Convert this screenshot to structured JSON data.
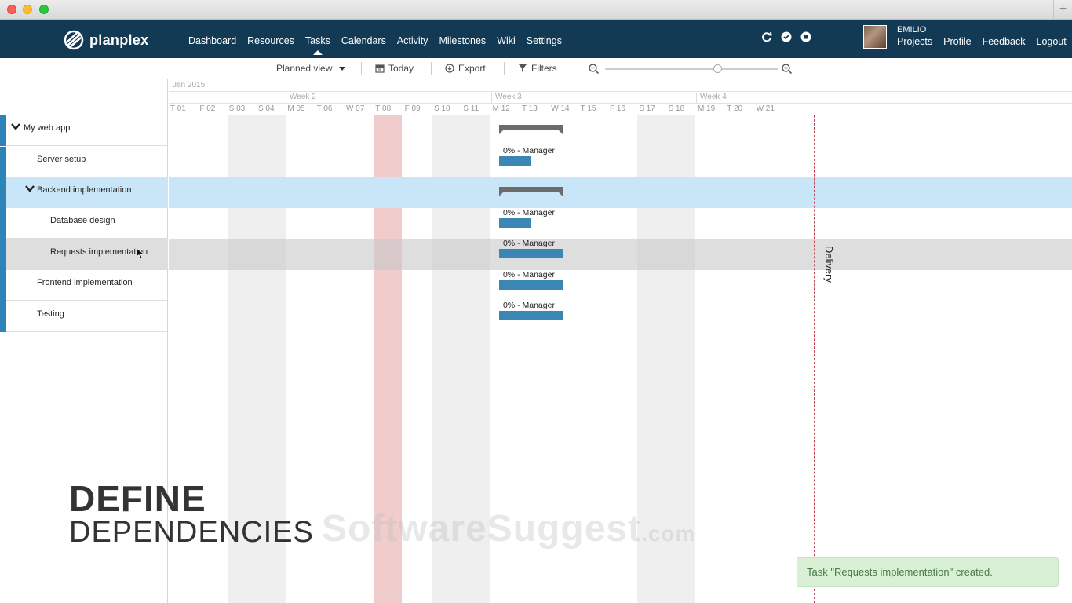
{
  "window": {
    "plus_label": "+"
  },
  "navbar": {
    "logo_text": "planplex",
    "links": [
      "Dashboard",
      "Resources",
      "Tasks",
      "Calendars",
      "Activity",
      "Milestones",
      "Wiki",
      "Settings"
    ],
    "active_link": "Tasks",
    "icons": [
      "refresh-icon",
      "check-circle-icon",
      "stop-circle-icon"
    ],
    "user_name": "EMILIO",
    "user_links": [
      "Projects",
      "Profile",
      "Feedback",
      "Logout"
    ]
  },
  "toolbar": {
    "view_label": "Planned view",
    "today_label": "Today",
    "export_label": "Export",
    "filters_label": "Filters",
    "zoom_level": 0.65
  },
  "timeline": {
    "month": "Jan 2015",
    "weeks": [
      "Week 2",
      "Week 3",
      "Week 4"
    ],
    "days": [
      "T 01",
      "F 02",
      "S 03",
      "S 04",
      "M 05",
      "T 06",
      "W 07",
      "T 08",
      "F 09",
      "S 10",
      "S 11",
      "M 12",
      "T 13",
      "W 14",
      "T 15",
      "F 16",
      "S 17",
      "S 18",
      "M 19",
      "T 20",
      "W 21"
    ]
  },
  "tasks": [
    {
      "label": "My web app",
      "level": 0,
      "collapsible": true
    },
    {
      "label": "Server setup",
      "level": 1,
      "collapsible": false,
      "bar_text": "0% - Manager"
    },
    {
      "label": "Backend implementation",
      "level": 1,
      "collapsible": true
    },
    {
      "label": "Database design",
      "level": 2,
      "collapsible": false,
      "bar_text": "0% - Manager"
    },
    {
      "label": "Requests implementation",
      "level": 2,
      "collapsible": false,
      "bar_text": "0% - Manager"
    },
    {
      "label": "Frontend implementation",
      "level": 1,
      "collapsible": false,
      "bar_text": "0% - Manager"
    },
    {
      "label": "Testing",
      "level": 1,
      "collapsible": false,
      "bar_text": "0% - Manager"
    }
  ],
  "milestone": {
    "label": "Delivery"
  },
  "overlay": {
    "headline_1": "DEFINE",
    "headline_2": "DEPENDENCIES",
    "watermark": "SoftwareSuggest",
    "watermark_suffix": ".com"
  },
  "toast": {
    "message": "Task \"Requests implementation\" created."
  },
  "colors": {
    "navbar": "#123a55",
    "accent": "#2e84b8",
    "selected_row": "#c8e6f7",
    "hover_row": "#dedede",
    "today_column": "#f0cccc",
    "delivery_line": "#c04a5a",
    "toast_bg": "#d9f0d7"
  }
}
